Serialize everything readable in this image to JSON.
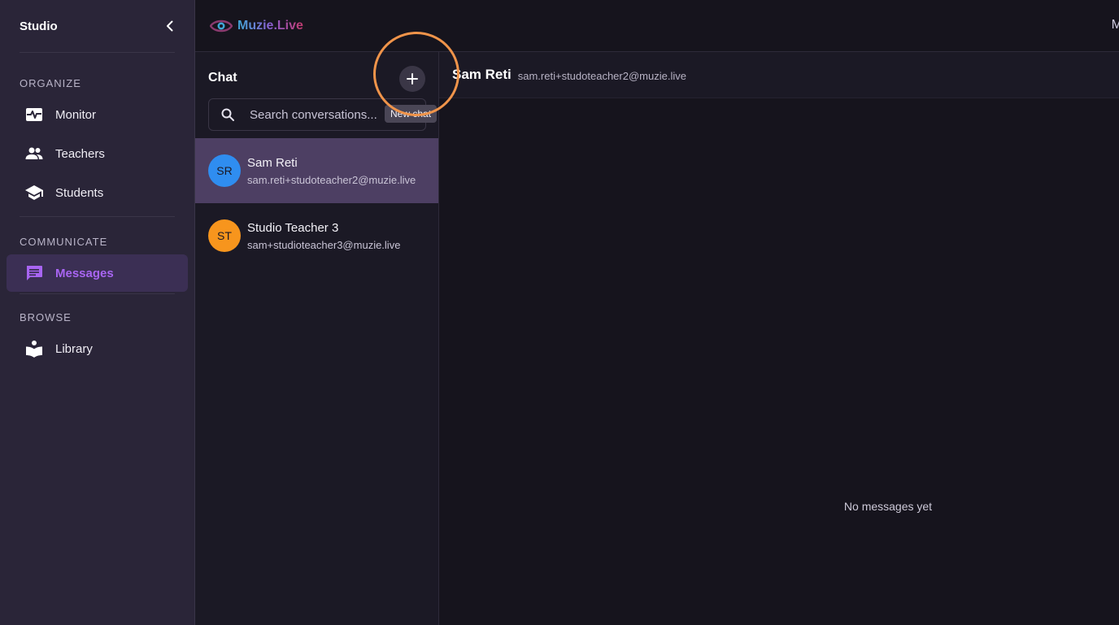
{
  "sidebar": {
    "title": "Studio",
    "sections": [
      {
        "label": "ORGANIZE"
      },
      {
        "label": "COMMUNICATE"
      },
      {
        "label": "BROWSE"
      }
    ],
    "items": [
      {
        "label": "Monitor",
        "icon": "monitor-heart-icon"
      },
      {
        "label": "Teachers",
        "icon": "people-icon"
      },
      {
        "label": "Students",
        "icon": "graduation-cap-icon"
      },
      {
        "label": "Messages",
        "icon": "message-icon",
        "active": true
      },
      {
        "label": "Library",
        "icon": "reader-icon"
      }
    ]
  },
  "header": {
    "brand": "Muzie.Live",
    "right_text": "M"
  },
  "chat": {
    "title": "Chat",
    "search_placeholder": "Search conversations...",
    "new_chat_tooltip": "New chat",
    "conversations": [
      {
        "initials": "SR",
        "name": "Sam Reti",
        "email": "sam.reti+studoteacher2@muzie.live",
        "avatar_color": "#2f8df0",
        "active": true
      },
      {
        "initials": "ST",
        "name": "Studio Teacher 3",
        "email": "sam+studioteacher3@muzie.live",
        "avatar_color": "#f7951d",
        "active": false
      }
    ]
  },
  "conversation": {
    "name": "Sam Reti",
    "email": "sam.reti+studoteacher2@muzie.live",
    "empty_text": "No messages yet"
  },
  "colors": {
    "accent": "#a865f2",
    "highlight_ring": "#f0944a"
  }
}
